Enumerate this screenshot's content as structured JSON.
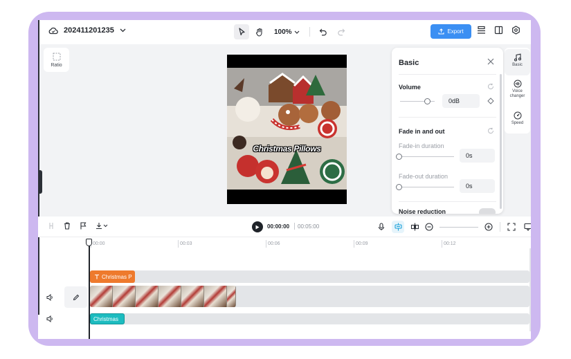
{
  "topbar": {
    "project_name": "202411201235",
    "zoom": "100%",
    "export_label": "Export"
  },
  "stage": {
    "ratio_label": "Ratio",
    "preview_caption": "Christmas Pillows"
  },
  "basic_panel": {
    "title": "Basic",
    "volume_label": "Volume",
    "volume_value": "0dB",
    "volume_level": 0.7,
    "fade_label": "Fade in and out",
    "fade_in_label": "Fade-in duration",
    "fade_in_value": "0s",
    "fade_out_label": "Fade-out duration",
    "fade_out_value": "0s",
    "cut_off_label": "Noise reduction"
  },
  "sidebar": {
    "items": [
      {
        "label": "Basic",
        "icon": "music-note-icon",
        "active": true
      },
      {
        "label": "Voice changer",
        "icon": "voice-changer-icon",
        "active": false
      },
      {
        "label": "Speed",
        "icon": "speed-icon",
        "active": false
      }
    ]
  },
  "timeline": {
    "current_time": "00:00:00",
    "total_time": "00:05:00",
    "ruler": [
      "00:00",
      "00:03",
      "00:06",
      "00:09",
      "00:12"
    ],
    "text_clip": "Christmas P",
    "audio_clip": "Christmas",
    "video_thumbnail_count": 7
  },
  "colors": {
    "frame": "#cdb8f0",
    "accent": "#3b8ff3",
    "text_clip": "#ee7a2d",
    "audio_clip": "#1dbcc0"
  }
}
